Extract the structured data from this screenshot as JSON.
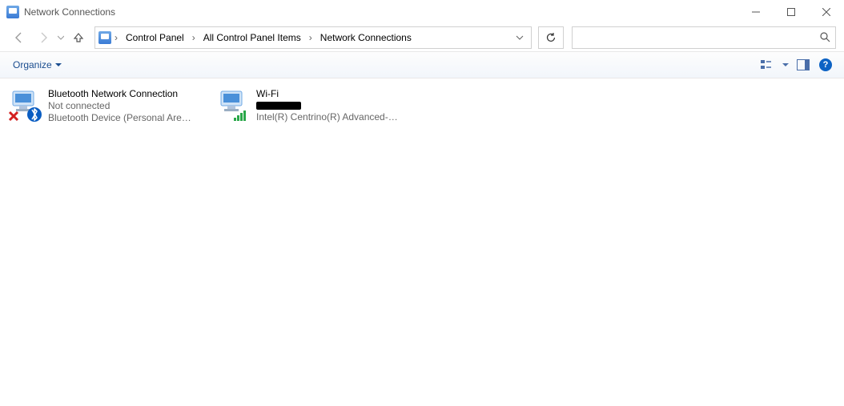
{
  "window": {
    "title": "Network Connections"
  },
  "breadcrumb": {
    "seg1": "Control Panel",
    "seg2": "All Control Panel Items",
    "seg3": "Network Connections"
  },
  "toolbar": {
    "organize": "Organize",
    "help": "?"
  },
  "search": {
    "placeholder": ""
  },
  "items": {
    "bluetooth": {
      "name": "Bluetooth Network Connection",
      "status": "Not connected",
      "device": "Bluetooth Device (Personal Area ..."
    },
    "wifi": {
      "name": "Wi-Fi",
      "device": "Intel(R) Centrino(R) Advanced-N ..."
    }
  }
}
